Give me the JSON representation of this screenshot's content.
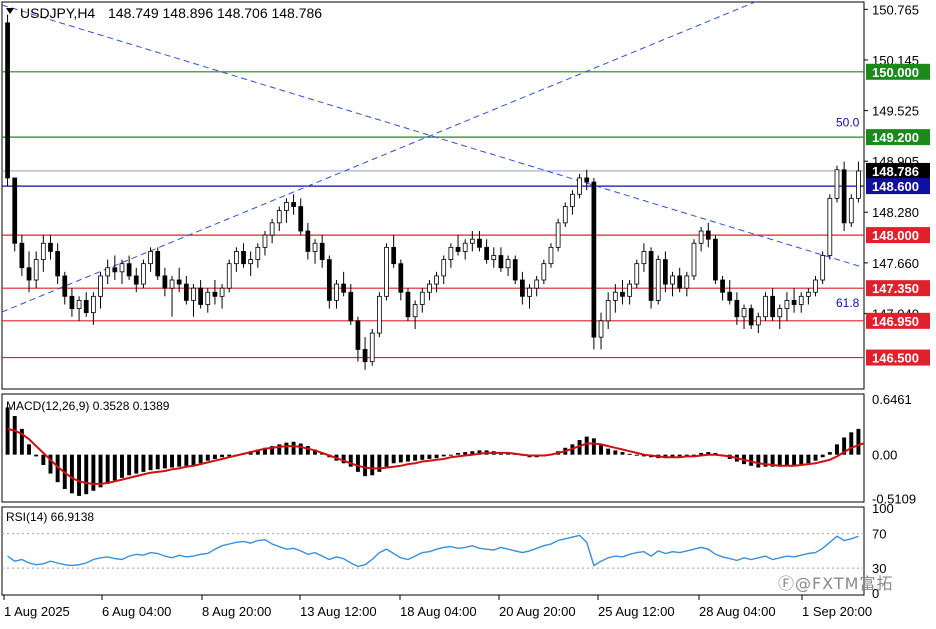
{
  "header": {
    "symbol": "USDJPY,H4",
    "ohlc": "148.749 148.896 148.706 148.786"
  },
  "colors": {
    "candle": "#000000",
    "candle_up_fill": "#ffffff",
    "support": "#e0202a",
    "resistance_green": "#1a8a1a",
    "blue_line": "#1010a0",
    "trend_dash": "#3050d0",
    "macd_signal": "#d01010",
    "rsi_line": "#3a8fd8",
    "current_price_bg": "#000000"
  },
  "price_axis": {
    "ticks": [
      "150.765",
      "150.145",
      "149.525",
      "148.905",
      "148.280",
      "147.660",
      "147.040"
    ],
    "tick_values": [
      150.765,
      150.145,
      149.525,
      148.905,
      148.28,
      147.66,
      147.04
    ]
  },
  "levels": [
    {
      "value": 150.0,
      "label": "150.000",
      "type": "green"
    },
    {
      "value": 149.2,
      "label": "149.200",
      "type": "green"
    },
    {
      "value": 148.786,
      "label": "148.786",
      "type": "current"
    },
    {
      "value": 148.6,
      "label": "148.600",
      "type": "blue"
    },
    {
      "value": 148.0,
      "label": "148.000",
      "type": "red"
    },
    {
      "value": 147.35,
      "label": "147.350",
      "type": "red"
    },
    {
      "value": 146.95,
      "label": "146.950",
      "type": "red"
    },
    {
      "value": 146.5,
      "label": "146.500",
      "type": "red"
    }
  ],
  "fib_labels": [
    {
      "text": "50.0",
      "value": 149.28
    },
    {
      "text": "61.8",
      "value": 147.07
    }
  ],
  "time_axis": [
    "1 Aug 2025",
    "6 Aug 04:00",
    "8 Aug 20:00",
    "13 Aug 12:00",
    "18 Aug 04:00",
    "20 Aug 20:00",
    "25 Aug 12:00",
    "28 Aug 04:00",
    "1 Sep 20:00"
  ],
  "macd": {
    "label": "MACD(12,26,9) 0.3528 0.1389",
    "ticks": [
      "0.6461",
      "0.00",
      "-0.5109"
    ]
  },
  "rsi": {
    "label": "RSI(14) 66.9138",
    "ticks": [
      "100",
      "70",
      "30",
      "0"
    ]
  },
  "watermark": "Ⓕ@FXTM富拓",
  "chart_data": {
    "type": "candlestick",
    "title": "USDJPY,H4",
    "ylim": [
      146.1,
      150.8
    ],
    "candles": [
      [
        150.6,
        150.7,
        148.6,
        148.7
      ],
      [
        148.7,
        148.7,
        147.8,
        147.9
      ],
      [
        147.9,
        148.0,
        147.5,
        147.6
      ],
      [
        147.6,
        147.8,
        147.3,
        147.45
      ],
      [
        147.45,
        147.8,
        147.35,
        147.7
      ],
      [
        147.7,
        148.0,
        147.55,
        147.9
      ],
      [
        147.9,
        148.0,
        147.7,
        147.8
      ],
      [
        147.8,
        147.9,
        147.4,
        147.5
      ],
      [
        147.5,
        147.55,
        147.15,
        147.25
      ],
      [
        147.25,
        147.35,
        147.0,
        147.1
      ],
      [
        147.1,
        147.25,
        146.95,
        147.2
      ],
      [
        147.2,
        147.3,
        147.0,
        147.05
      ],
      [
        147.05,
        147.3,
        146.9,
        147.25
      ],
      [
        147.25,
        147.55,
        147.1,
        147.5
      ],
      [
        147.5,
        147.7,
        147.4,
        147.6
      ],
      [
        147.6,
        147.75,
        147.45,
        147.55
      ],
      [
        147.55,
        147.7,
        147.4,
        147.65
      ],
      [
        147.65,
        147.75,
        147.45,
        147.5
      ],
      [
        147.5,
        147.6,
        147.3,
        147.4
      ],
      [
        147.4,
        147.7,
        147.35,
        147.65
      ],
      [
        147.65,
        147.85,
        147.55,
        147.8
      ],
      [
        147.8,
        147.85,
        147.45,
        147.5
      ],
      [
        147.5,
        147.6,
        147.25,
        147.35
      ],
      [
        147.35,
        147.5,
        147.0,
        147.45
      ],
      [
        147.45,
        147.6,
        147.3,
        147.4
      ],
      [
        147.4,
        147.5,
        147.15,
        147.2
      ],
      [
        147.2,
        147.4,
        147.0,
        147.35
      ],
      [
        147.35,
        147.45,
        147.1,
        147.15
      ],
      [
        147.15,
        147.35,
        147.05,
        147.3
      ],
      [
        147.3,
        147.45,
        147.15,
        147.25
      ],
      [
        147.25,
        147.4,
        147.1,
        147.35
      ],
      [
        147.35,
        147.7,
        147.3,
        147.65
      ],
      [
        147.65,
        147.85,
        147.55,
        147.8
      ],
      [
        147.8,
        147.9,
        147.6,
        147.65
      ],
      [
        147.65,
        147.8,
        147.5,
        147.7
      ],
      [
        147.7,
        147.9,
        147.6,
        147.85
      ],
      [
        147.85,
        148.05,
        147.75,
        148.0
      ],
      [
        148.0,
        148.2,
        147.9,
        148.15
      ],
      [
        148.15,
        148.35,
        148.05,
        148.3
      ],
      [
        148.3,
        148.45,
        148.15,
        148.4
      ],
      [
        148.4,
        148.5,
        148.25,
        148.35
      ],
      [
        148.35,
        148.45,
        148.0,
        148.05
      ],
      [
        148.05,
        148.15,
        147.7,
        147.8
      ],
      [
        147.8,
        147.95,
        147.65,
        147.9
      ],
      [
        147.9,
        148.0,
        147.6,
        147.7
      ],
      [
        147.7,
        147.75,
        147.1,
        147.2
      ],
      [
        147.2,
        147.45,
        147.1,
        147.4
      ],
      [
        147.4,
        147.55,
        147.25,
        147.3
      ],
      [
        147.3,
        147.4,
        146.9,
        146.95
      ],
      [
        146.95,
        147.0,
        146.45,
        146.6
      ],
      [
        146.6,
        146.75,
        146.35,
        146.45
      ],
      [
        146.45,
        146.85,
        146.4,
        146.8
      ],
      [
        146.8,
        147.3,
        146.75,
        147.25
      ],
      [
        147.25,
        147.9,
        147.2,
        147.85
      ],
      [
        147.85,
        148.0,
        147.6,
        147.65
      ],
      [
        147.65,
        147.7,
        147.2,
        147.3
      ],
      [
        147.3,
        147.35,
        146.95,
        147.0
      ],
      [
        147.0,
        147.2,
        146.85,
        147.15
      ],
      [
        147.15,
        147.35,
        147.05,
        147.3
      ],
      [
        147.3,
        147.45,
        147.2,
        147.4
      ],
      [
        147.4,
        147.55,
        147.3,
        147.5
      ],
      [
        147.5,
        147.75,
        147.4,
        147.7
      ],
      [
        147.7,
        147.9,
        147.6,
        147.85
      ],
      [
        147.85,
        148.0,
        147.75,
        147.8
      ],
      [
        147.8,
        147.95,
        147.7,
        147.9
      ],
      [
        147.9,
        148.05,
        147.8,
        147.95
      ],
      [
        147.95,
        148.05,
        147.8,
        147.85
      ],
      [
        147.85,
        147.95,
        147.65,
        147.7
      ],
      [
        147.7,
        147.85,
        147.6,
        147.75
      ],
      [
        147.75,
        147.85,
        147.55,
        147.6
      ],
      [
        147.6,
        147.75,
        147.5,
        147.7
      ],
      [
        147.7,
        147.75,
        147.4,
        147.45
      ],
      [
        147.45,
        147.55,
        147.15,
        147.25
      ],
      [
        147.25,
        147.4,
        147.1,
        147.35
      ],
      [
        147.35,
        147.5,
        147.25,
        147.45
      ],
      [
        147.45,
        147.7,
        147.4,
        147.65
      ],
      [
        147.65,
        147.9,
        147.6,
        147.85
      ],
      [
        147.85,
        148.2,
        147.8,
        148.15
      ],
      [
        148.15,
        148.4,
        148.1,
        148.35
      ],
      [
        148.35,
        148.55,
        148.25,
        148.5
      ],
      [
        148.5,
        148.75,
        148.45,
        148.7
      ],
      [
        148.7,
        148.8,
        148.55,
        148.65
      ],
      [
        148.65,
        148.7,
        146.6,
        146.75
      ],
      [
        146.75,
        147.05,
        146.6,
        146.95
      ],
      [
        146.95,
        147.3,
        146.85,
        147.2
      ],
      [
        147.2,
        147.4,
        147.05,
        147.3
      ],
      [
        147.3,
        147.45,
        147.15,
        147.25
      ],
      [
        147.25,
        147.45,
        147.15,
        147.4
      ],
      [
        147.4,
        147.7,
        147.35,
        147.65
      ],
      [
        147.65,
        147.9,
        147.55,
        147.8
      ],
      [
        147.8,
        147.85,
        147.1,
        147.2
      ],
      [
        147.2,
        147.75,
        147.15,
        147.7
      ],
      [
        147.7,
        147.8,
        147.3,
        147.4
      ],
      [
        147.4,
        147.55,
        147.25,
        147.5
      ],
      [
        147.5,
        147.6,
        147.3,
        147.35
      ],
      [
        147.35,
        147.55,
        147.25,
        147.5
      ],
      [
        147.5,
        147.95,
        147.45,
        147.9
      ],
      [
        147.9,
        148.1,
        147.8,
        148.05
      ],
      [
        148.05,
        148.15,
        147.85,
        147.95
      ],
      [
        147.95,
        148.0,
        147.4,
        147.45
      ],
      [
        147.45,
        147.5,
        147.2,
        147.3
      ],
      [
        147.3,
        147.45,
        147.15,
        147.2
      ],
      [
        147.2,
        147.3,
        146.9,
        147.0
      ],
      [
        147.0,
        147.15,
        146.85,
        147.1
      ],
      [
        147.1,
        147.15,
        146.85,
        146.9
      ],
      [
        146.9,
        147.05,
        146.8,
        147.0
      ],
      [
        147.0,
        147.3,
        146.95,
        147.25
      ],
      [
        147.25,
        147.35,
        146.95,
        147.0
      ],
      [
        147.0,
        147.15,
        146.85,
        147.1
      ],
      [
        147.1,
        147.3,
        146.95,
        147.2
      ],
      [
        147.2,
        147.35,
        147.05,
        147.15
      ],
      [
        147.15,
        147.3,
        147.05,
        147.25
      ],
      [
        147.25,
        147.35,
        147.15,
        147.3
      ],
      [
        147.3,
        147.5,
        147.25,
        147.45
      ],
      [
        147.45,
        147.8,
        147.4,
        147.75
      ],
      [
        147.75,
        148.5,
        147.7,
        148.45
      ],
      [
        148.45,
        148.85,
        148.4,
        148.8
      ],
      [
        148.8,
        148.9,
        148.05,
        148.15
      ],
      [
        148.15,
        148.5,
        148.1,
        148.45
      ],
      [
        148.45,
        148.9,
        148.4,
        148.786
      ]
    ],
    "macd_hist": [
      0.55,
      0.45,
      0.3,
      0.12,
      -0.02,
      -0.12,
      -0.22,
      -0.32,
      -0.4,
      -0.45,
      -0.48,
      -0.46,
      -0.42,
      -0.38,
      -0.34,
      -0.3,
      -0.27,
      -0.24,
      -0.22,
      -0.2,
      -0.18,
      -0.17,
      -0.16,
      -0.15,
      -0.14,
      -0.13,
      -0.12,
      -0.1,
      -0.07,
      -0.05,
      -0.03,
      -0.02,
      0.0,
      0.02,
      0.04,
      0.06,
      0.08,
      0.1,
      0.12,
      0.14,
      0.15,
      0.13,
      0.1,
      0.06,
      0.02,
      -0.03,
      -0.07,
      -0.1,
      -0.14,
      -0.2,
      -0.25,
      -0.24,
      -0.2,
      -0.14,
      -0.1,
      -0.09,
      -0.08,
      -0.07,
      -0.06,
      -0.05,
      -0.04,
      -0.02,
      0.0,
      0.02,
      0.03,
      0.04,
      0.05,
      0.05,
      0.04,
      0.03,
      0.02,
      0.01,
      -0.01,
      -0.03,
      -0.03,
      -0.02,
      0.01,
      0.04,
      0.08,
      0.12,
      0.17,
      0.21,
      0.19,
      0.12,
      0.07,
      0.05,
      0.03,
      0.01,
      -0.01,
      -0.02,
      -0.03,
      -0.04,
      -0.04,
      -0.03,
      -0.02,
      -0.01,
      0.0,
      0.02,
      0.03,
      0.02,
      -0.02,
      -0.05,
      -0.08,
      -0.11,
      -0.13,
      -0.15,
      -0.14,
      -0.14,
      -0.14,
      -0.13,
      -0.12,
      -0.11,
      -0.1,
      -0.07,
      -0.03,
      0.03,
      0.12,
      0.2,
      0.26,
      0.3,
      0.35
    ],
    "macd_signal": [
      0.3,
      0.28,
      0.24,
      0.18,
      0.1,
      0.02,
      -0.06,
      -0.14,
      -0.21,
      -0.27,
      -0.31,
      -0.33,
      -0.34,
      -0.34,
      -0.33,
      -0.31,
      -0.29,
      -0.27,
      -0.25,
      -0.23,
      -0.21,
      -0.2,
      -0.19,
      -0.17,
      -0.16,
      -0.14,
      -0.13,
      -0.11,
      -0.09,
      -0.07,
      -0.05,
      -0.03,
      -0.01,
      0.01,
      0.03,
      0.05,
      0.07,
      0.08,
      0.09,
      0.1,
      0.1,
      0.09,
      0.07,
      0.05,
      0.02,
      -0.01,
      -0.04,
      -0.07,
      -0.1,
      -0.13,
      -0.15,
      -0.16,
      -0.16,
      -0.15,
      -0.14,
      -0.13,
      -0.11,
      -0.1,
      -0.08,
      -0.07,
      -0.06,
      -0.05,
      -0.03,
      -0.02,
      -0.01,
      0.0,
      0.01,
      0.02,
      0.02,
      0.02,
      0.02,
      0.01,
      0.0,
      -0.01,
      -0.01,
      -0.01,
      0.0,
      0.02,
      0.04,
      0.07,
      0.1,
      0.13,
      0.13,
      0.12,
      0.1,
      0.08,
      0.06,
      0.04,
      0.02,
      0.0,
      -0.01,
      -0.02,
      -0.03,
      -0.03,
      -0.03,
      -0.02,
      -0.02,
      -0.01,
      0.0,
      0.0,
      -0.01,
      -0.02,
      -0.04,
      -0.06,
      -0.08,
      -0.1,
      -0.11,
      -0.12,
      -0.13,
      -0.13,
      -0.13,
      -0.12,
      -0.11,
      -0.1,
      -0.08,
      -0.06,
      -0.02,
      0.03,
      0.08,
      0.11,
      0.14
    ],
    "rsi": [
      44,
      38,
      40,
      36,
      34,
      35,
      38,
      36,
      34,
      33,
      34,
      36,
      40,
      42,
      43,
      41,
      40,
      44,
      46,
      45,
      48,
      47,
      44,
      42,
      45,
      43,
      44,
      46,
      47,
      52,
      56,
      58,
      60,
      61,
      59,
      62,
      63,
      58,
      55,
      52,
      53,
      50,
      46,
      48,
      44,
      40,
      43,
      41,
      36,
      32,
      34,
      40,
      48,
      52,
      47,
      42,
      40,
      44,
      48,
      49,
      52,
      54,
      55,
      53,
      54,
      56,
      53,
      52,
      51,
      54,
      52,
      50,
      48,
      50,
      53,
      56,
      58,
      62,
      64,
      66,
      68,
      60,
      33,
      38,
      42,
      44,
      43,
      46,
      48,
      49,
      44,
      50,
      47,
      49,
      48,
      50,
      52,
      54,
      52,
      46,
      43,
      41,
      39,
      42,
      40,
      42,
      44,
      40,
      42,
      44,
      43,
      45,
      47,
      48,
      53,
      60,
      67,
      62,
      64,
      66.9
    ],
    "price_axis_ticks": [
      150.765,
      150.145,
      149.525,
      148.905,
      148.28,
      147.66,
      147.04
    ]
  }
}
